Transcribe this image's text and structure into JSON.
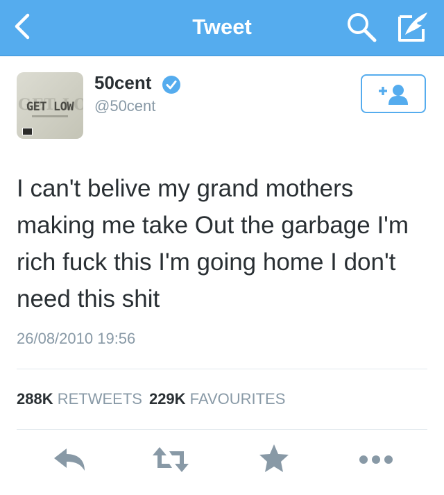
{
  "header": {
    "title": "Tweet",
    "back_icon": "chevron-left-icon",
    "search_icon": "search-icon",
    "compose_icon": "compose-icon",
    "background_color": "#55acee"
  },
  "tweet": {
    "author": {
      "display_name": "50cent",
      "handle": "@50cent",
      "verified": true,
      "avatar_logo_text": "GET LOW"
    },
    "text": "I can't belive my grand mothers making me take Out the garbage I'm rich fuck this I'm going home I don't need this shit",
    "timestamp": "26/08/2010 19:56",
    "stats": {
      "retweets_count": "288K",
      "retweets_label": "RETWEETS",
      "favourites_count": "229K",
      "favourites_label": "FAVOURITES"
    }
  },
  "actions": [
    {
      "name": "reply",
      "icon": "reply-icon"
    },
    {
      "name": "retweet",
      "icon": "retweet-icon"
    },
    {
      "name": "favourite",
      "icon": "star-icon"
    },
    {
      "name": "more",
      "icon": "more-icon"
    }
  ],
  "colors": {
    "accent": "#55acee",
    "text": "#292f33",
    "secondary_text": "#8899a6",
    "action_icon": "#8899a6",
    "divider": "#e1e8ed"
  }
}
